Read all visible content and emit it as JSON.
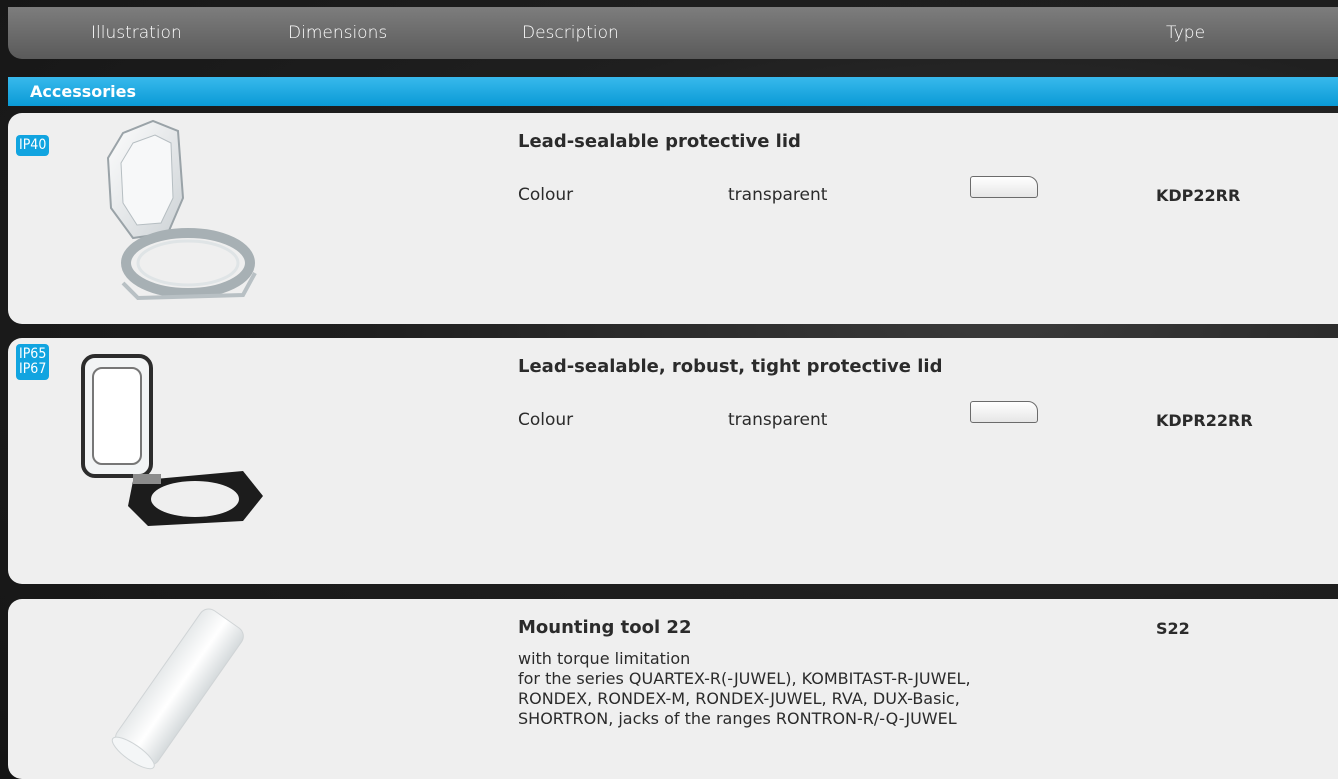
{
  "header": {
    "col_illustration": "Illustration",
    "col_dimensions": "Dimensions",
    "col_description": "Description",
    "col_type": "Type"
  },
  "category": {
    "label": "Accessories"
  },
  "products": [
    {
      "ip_line1": "IP40",
      "title": "Lead-sealable protective lid",
      "attr_label": "Colour",
      "attr_value": "transparent",
      "type": "KDP22RR"
    },
    {
      "ip_line1": "IP65",
      "ip_line2": "IP67",
      "title": "Lead-sealable, robust, tight protective lid",
      "attr_label": "Colour",
      "attr_value": "transparent",
      "type": "KDPR22RR"
    },
    {
      "title": "Mounting tool 22",
      "desc_lines": [
        "with torque limitation",
        "for the series QUARTEX-R(-JUWEL), KOMBITAST-R-JUWEL,",
        "RONDEX, RONDEX-M, RONDEX-JUWEL, RVA, DUX-Basic,",
        "SHORTRON, jacks of the ranges RONTRON-R/-Q-JUWEL"
      ],
      "type": "S22"
    }
  ],
  "colors": {
    "accent": "#11a4e0",
    "header": "#6b6b6b",
    "card": "#efefef"
  }
}
